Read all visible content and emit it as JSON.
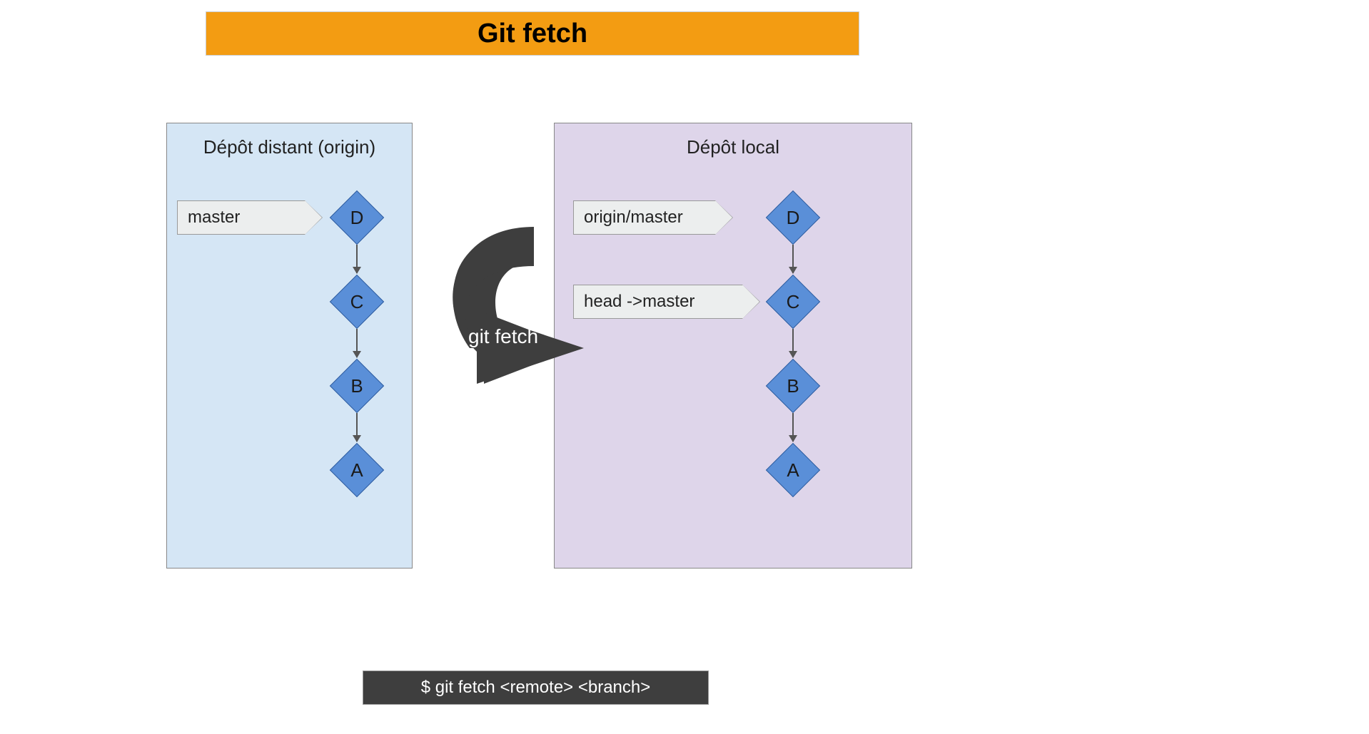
{
  "title": "Git fetch",
  "remote_panel": {
    "title": "Dépôt distant (origin)",
    "commits": [
      "D",
      "C",
      "B",
      "A"
    ],
    "branch_tag": "master"
  },
  "local_panel": {
    "title": "Dépôt local",
    "commits": [
      "D",
      "C",
      "B",
      "A"
    ],
    "branch_tags": [
      "origin/master",
      "head ->master"
    ]
  },
  "arrow_label": "git fetch",
  "command": "$ git fetch <remote> <branch>"
}
